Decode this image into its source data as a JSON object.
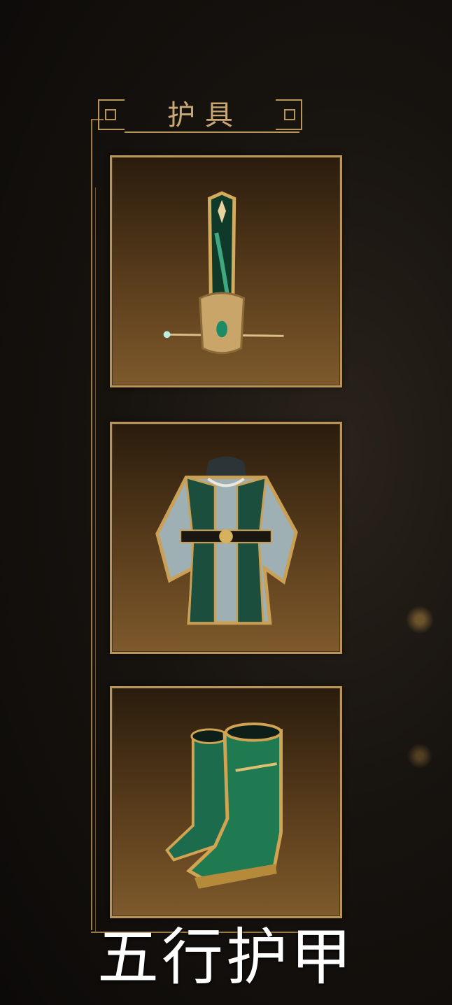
{
  "section": {
    "title": "护具"
  },
  "slots": [
    {
      "icon": "bracer-icon"
    },
    {
      "icon": "robe-armor-icon"
    },
    {
      "icon": "boots-icon"
    }
  ],
  "caption": "五行护甲",
  "colors": {
    "gold": "#b99459",
    "jade": "#1f7a52",
    "slot_bg": "#5a3d1c"
  }
}
